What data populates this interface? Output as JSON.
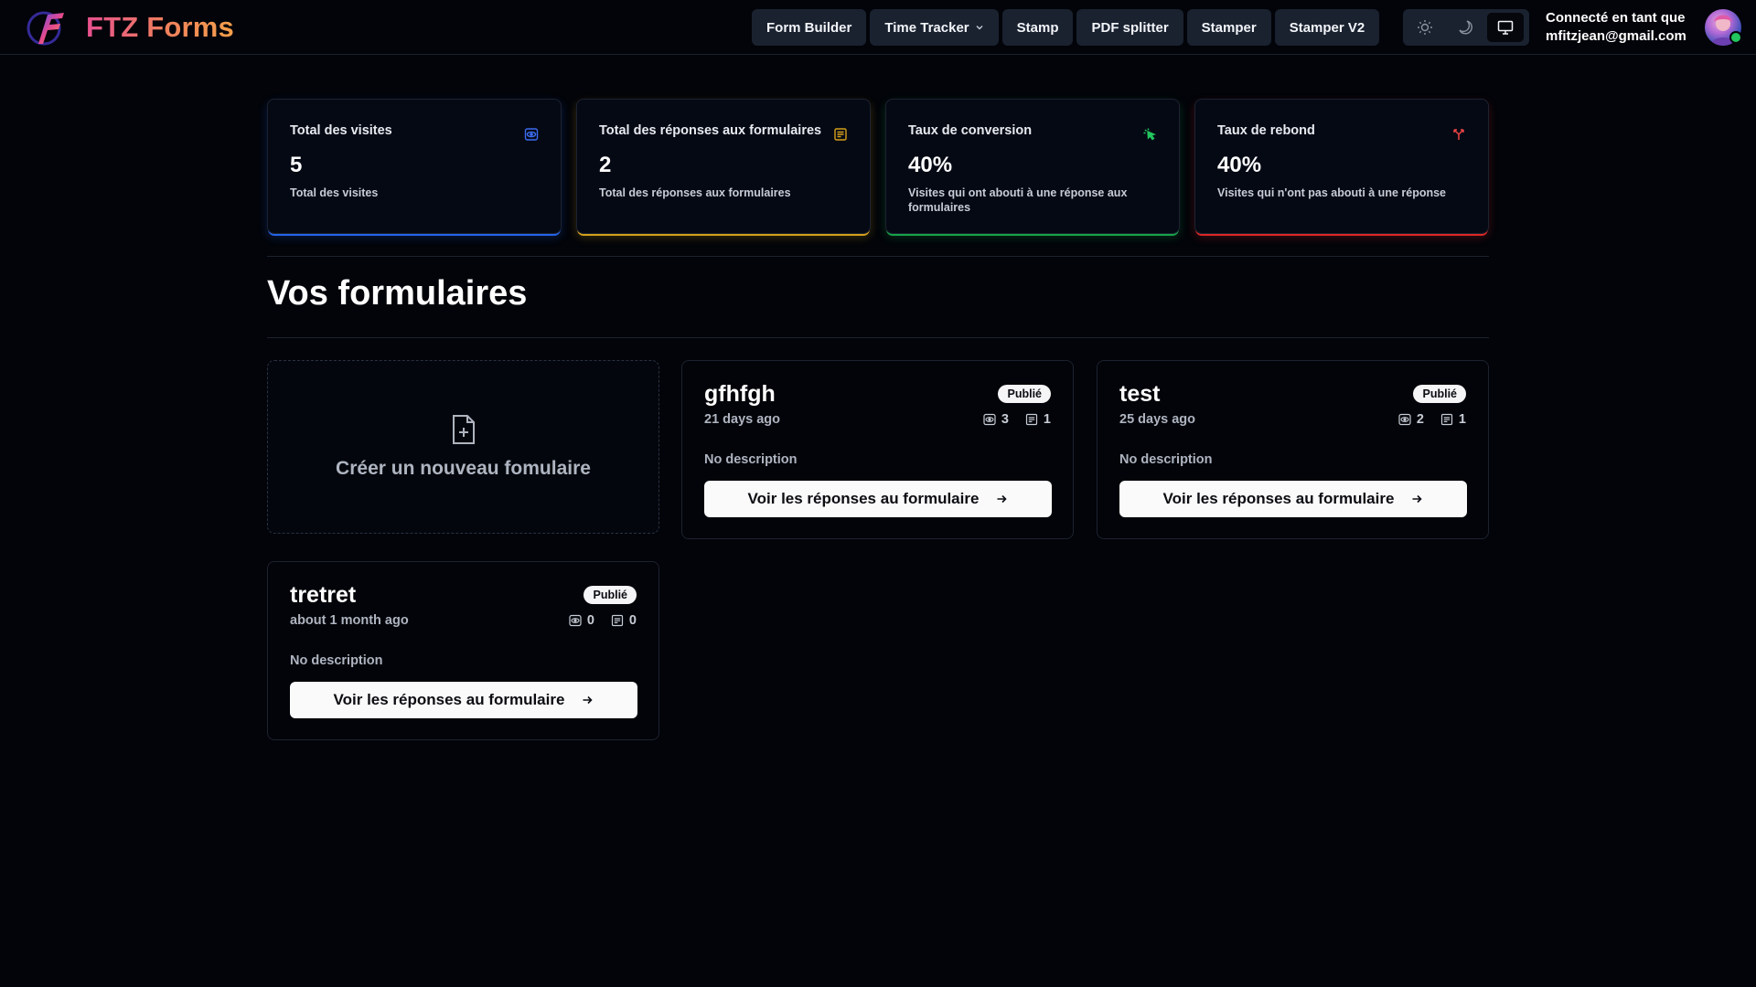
{
  "brand": {
    "name": "FTZ Forms"
  },
  "nav": {
    "links": [
      {
        "label": "Form Builder"
      },
      {
        "label": "Time Tracker",
        "has_dropdown": true
      },
      {
        "label": "Stamp"
      },
      {
        "label": "PDF splitter"
      },
      {
        "label": "Stamper"
      },
      {
        "label": "Stamper V2"
      }
    ],
    "theme_options": [
      "sun-icon",
      "moon-icon",
      "monitor-icon"
    ],
    "theme_active": "monitor-icon"
  },
  "user": {
    "line1": "Connecté en tant que",
    "email": "mfitzjean@gmail.com",
    "status_color": "#22c55e"
  },
  "stats": [
    {
      "title": "Total des visites",
      "value": "5",
      "helper": "Total des visites",
      "icon": "eye-icon",
      "color": "#2563eb"
    },
    {
      "title": "Total des réponses aux formulaires",
      "value": "2",
      "helper": "Total des réponses aux formulaires",
      "icon": "form-icon",
      "color": "#d5a01a"
    },
    {
      "title": "Taux de conversion",
      "value": "40%",
      "helper": "Visites qui ont abouti à une réponse aux formulaires",
      "icon": "cursor-click-icon",
      "color": "#16a34a"
    },
    {
      "title": "Taux de rebond",
      "value": "40%",
      "helper": "Visites qui n'ont pas abouti à une réponse",
      "icon": "split-arrow-icon",
      "color": "#dc2626"
    }
  ],
  "forms_section": {
    "title": "Vos formulaires",
    "create_label": "Créer un nouveau fomulaire",
    "forms": [
      {
        "name": "gfhfgh",
        "status": "Publié",
        "date": "21 days ago",
        "visits": "3",
        "submissions": "1",
        "description": "No description",
        "button": "Voir les réponses au formulaire"
      },
      {
        "name": "test",
        "status": "Publié",
        "date": "25 days ago",
        "visits": "2",
        "submissions": "1",
        "description": "No description",
        "button": "Voir les réponses au formulaire"
      },
      {
        "name": "tretret",
        "status": "Publié",
        "date": "about 1 month ago",
        "visits": "0",
        "submissions": "0",
        "description": "No description",
        "button": "Voir les réponses au formulaire"
      }
    ]
  }
}
